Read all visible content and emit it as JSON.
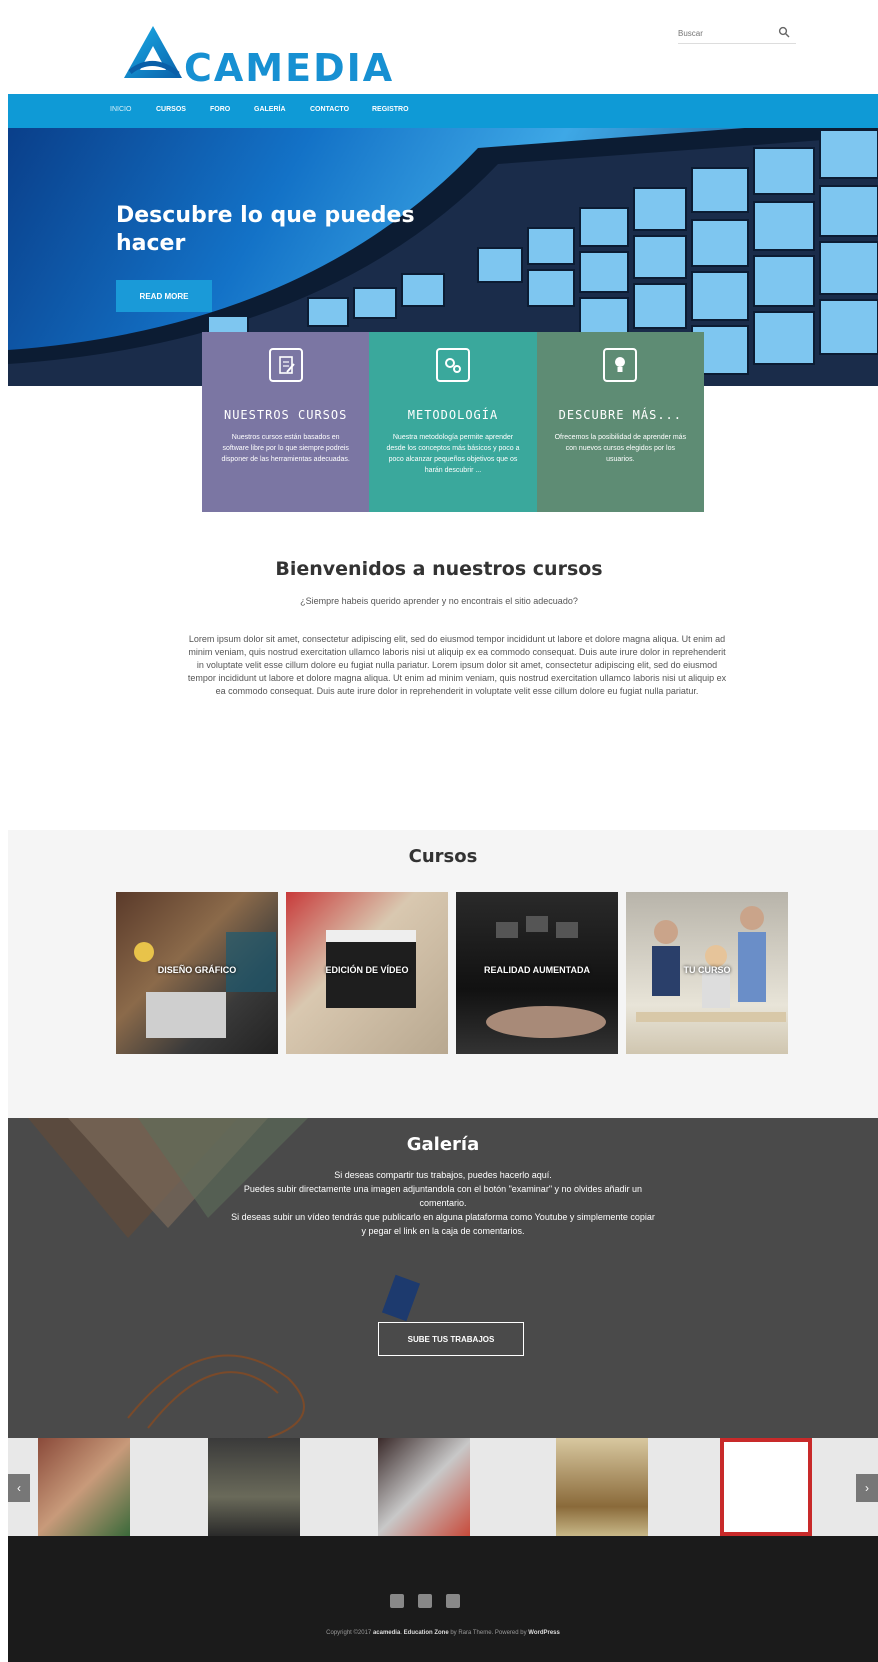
{
  "brand": {
    "logo_text": "CAMEDIA"
  },
  "search": {
    "placeholder": "Buscar"
  },
  "nav": {
    "items": [
      "INICIO",
      "CURSOS",
      "FORO",
      "GALERÍA",
      "CONTACTO",
      "REGISTRO"
    ]
  },
  "hero": {
    "title": "Descubre lo que puedes hacer",
    "button_label": "READ MORE"
  },
  "features": [
    {
      "title": "NUESTROS CURSOS",
      "desc": "Nuestros cursos están basados en software libre por lo que siempre podreis disponer de las herramientas adecuadas.",
      "icon": "edit-document-icon",
      "color": "#7b76a3"
    },
    {
      "title": "METODOLOGÍA",
      "desc": "Nuestra metodología permite aprender desde los conceptos más básicos y poco a poco alcanzar pequeños objetivos que os harán descubrir ...",
      "icon": "gears-icon",
      "color": "#3aa89c"
    },
    {
      "title": "DESCUBRE MÁS...",
      "desc": "Ofrecemos la posibilidad de aprender más con nuevos cursos elegidos por los usuarios.",
      "icon": "lightbulb-icon",
      "color": "#5e8c74"
    }
  ],
  "welcome": {
    "title": "Bienvenidos a nuestros cursos",
    "subtitle": "¿Siempre habeis querido aprender y no encontrais el sitio adecuado?",
    "body": "Lorem ipsum dolor sit amet, consectetur adipiscing elit, sed do eiusmod tempor incididunt ut labore et dolore magna aliqua. Ut enim ad minim veniam, quis nostrud exercitation ullamco laboris nisi ut aliquip ex ea commodo consequat. Duis aute irure dolor in reprehenderit in voluptate velit esse cillum dolore eu fugiat nulla pariatur. Lorem ipsum dolor sit amet, consectetur adipiscing elit, sed do eiusmod tempor incididunt ut labore et dolore magna aliqua. Ut enim ad minim veniam, quis nostrud exercitation ullamco laboris nisi ut aliquip ex ea commodo consequat. Duis aute irure dolor in reprehenderit in voluptate velit esse cillum dolore eu fugiat nulla pariatur."
  },
  "courses": {
    "title": "Cursos",
    "items": [
      {
        "label": "DISEÑO GRÁFICO"
      },
      {
        "label": "EDICIÓN DE VÍDEO"
      },
      {
        "label": "REALIDAD AUMENTADA"
      },
      {
        "label": "TU CURSO"
      }
    ]
  },
  "gallery": {
    "title": "Galería",
    "line1": "Si deseas compartir tus trabajos, puedes hacerlo aquí.",
    "line2": "Puedes subir directamente una imagen adjuntandola con el botón \"examinar\" y no olvides añadir un comentario.",
    "line3": "Si deseas subir un vídeo tendrás que publicarlo en alguna plataforma como Youtube y simplemente copiar y pegar el link en la caja de comentarios.",
    "button_label": "SUBE TUS TRABAJOS"
  },
  "carousel": {
    "prev_icon": "chevron-left-icon",
    "next_icon": "chevron-right-icon",
    "prev_glyph": "‹",
    "next_glyph": "›"
  },
  "footer": {
    "social_icons": [
      "facebook-icon",
      "instagram-icon",
      "linkedin-icon"
    ],
    "copyright_prefix": "Copyright ©2017",
    "site_name": "acamedia",
    "theme_name": "Education Zone",
    "by_text": "by Rara Theme. Powered by",
    "wordpress": "WordPress"
  },
  "colors": {
    "nav": "#0f9ad6",
    "logo": "#1790d2",
    "footer": "#1b1b1b"
  }
}
